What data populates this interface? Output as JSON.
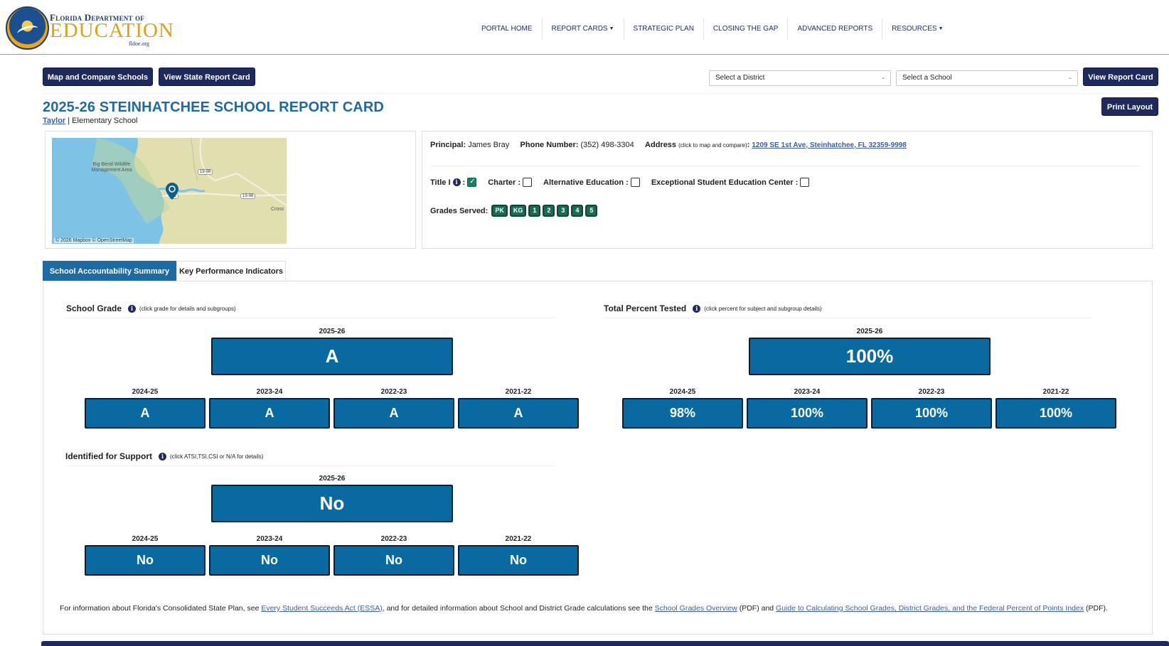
{
  "logo": {
    "line1": "Florida Department of",
    "line2": "EDUCATION",
    "line3": "fldoe.org"
  },
  "nav": [
    {
      "label": "PORTAL HOME",
      "dropdown": false
    },
    {
      "label": "REPORT CARDS",
      "dropdown": true
    },
    {
      "label": "STRATEGIC PLAN",
      "dropdown": false
    },
    {
      "label": "CLOSING THE GAP",
      "dropdown": false
    },
    {
      "label": "ADVANCED REPORTS",
      "dropdown": false
    },
    {
      "label": "RESOURCES",
      "dropdown": true
    }
  ],
  "toolbar": {
    "map_compare": "Map and Compare Schools",
    "state_report": "View State Report Card",
    "district_placeholder": "Select a District",
    "school_placeholder": "Select a School",
    "view_report": "View Report Card",
    "print_layout": "Print Layout"
  },
  "title": "2025-26 STEINHATCHEE SCHOOL REPORT CARD",
  "district": "Taylor",
  "school_type": "| Elementary School",
  "map": {
    "credit": "© 2026 Mapbox © OpenStreetMap",
    "area_label": "Big Bend Wildlife Management Area",
    "shield1": "19-98",
    "shield2": "19-98",
    "shield3": "58",
    "place_label": "Cross"
  },
  "info": {
    "principal_label": "Principal:",
    "principal": "James Bray",
    "phone_label": "Phone Number:",
    "phone": "(352) 498-3304",
    "address_label": "Address",
    "address_hint": "(click to map and compare)",
    "address": "1209 SE 1st Ave, Steinhatchee, FL 32359-9998",
    "title1_label": "Title I",
    "title1_checked": true,
    "charter_label": "Charter :",
    "charter_checked": false,
    "alt_ed_label": "Alternative Education :",
    "alt_ed_checked": false,
    "ese_label": "Exceptional Student Education Center :",
    "ese_checked": false,
    "grades_label": "Grades Served:",
    "grades": [
      "PK",
      "KG",
      "1",
      "2",
      "3",
      "4",
      "5"
    ]
  },
  "tabs": [
    {
      "label": "School Accountability Summary",
      "active": true
    },
    {
      "label": "Key Performance Indicators",
      "active": false
    }
  ],
  "school_grade": {
    "title": "School Grade",
    "hint": "(click grade for details and subgroups)",
    "current_year": "2025-26",
    "current_value": "A",
    "history": [
      {
        "year": "2024-25",
        "value": "A"
      },
      {
        "year": "2023-24",
        "value": "A"
      },
      {
        "year": "2022-23",
        "value": "A"
      },
      {
        "year": "2021-22",
        "value": "A"
      }
    ]
  },
  "percent_tested": {
    "title": "Total Percent Tested",
    "hint": "(click percent for subject and subgroup details)",
    "current_year": "2025-26",
    "current_value": "100%",
    "history": [
      {
        "year": "2024-25",
        "value": "98%"
      },
      {
        "year": "2023-24",
        "value": "100%"
      },
      {
        "year": "2022-23",
        "value": "100%"
      },
      {
        "year": "2021-22",
        "value": "100%"
      }
    ]
  },
  "support": {
    "title": "Identified for Support",
    "hint": "(click ATSI,TSI,CSI or N/A for details)",
    "current_year": "2025-26",
    "current_value": "No",
    "history": [
      {
        "year": "2024-25",
        "value": "No"
      },
      {
        "year": "2023-24",
        "value": "No"
      },
      {
        "year": "2022-23",
        "value": "No"
      },
      {
        "year": "2021-22",
        "value": "No"
      }
    ]
  },
  "footer": {
    "t1": "For information about Florida's Consolidated State Plan, see ",
    "link1": "Every Student Succeeds Act (ESSA)",
    "t2": ", and for detailed information about School and District Grade calculations see the ",
    "link2": "School Grades Overview",
    "t3": " (PDF) and ",
    "link3": "Guide to Calculating School Grades, District Grades, and the Federal Percent of Points Index",
    "t4": " (PDF)."
  },
  "colors": {
    "navy": "#1e2a5e",
    "tile_blue": "#086aa1",
    "title_blue": "#1e6aa3",
    "badge_green": "#1a6b55"
  }
}
